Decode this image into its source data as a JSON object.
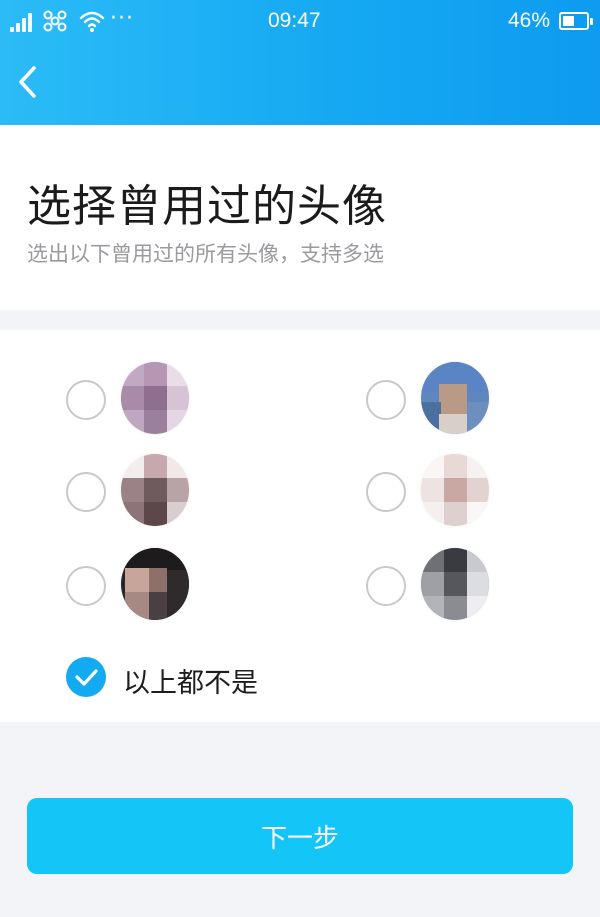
{
  "status_bar": {
    "time": "09:47",
    "battery": "46%",
    "more": "···",
    "icons": [
      "signal-icon",
      "carrier-icon",
      "wifi-icon",
      "battery-icon"
    ]
  },
  "nav": {
    "back_icon": "chevron-left-icon"
  },
  "title": "选择曾用过的头像",
  "subtitle": "选出以下曾用过的所有头像，支持多选",
  "avatar_options": [
    {
      "selected": false,
      "avatar": "pixelated-avatar"
    },
    {
      "selected": false,
      "avatar": "pixelated-avatar"
    },
    {
      "selected": false,
      "avatar": "pixelated-avatar"
    },
    {
      "selected": false,
      "avatar": "pixelated-avatar"
    },
    {
      "selected": false,
      "avatar": "pixelated-avatar"
    },
    {
      "selected": false,
      "avatar": "pixelated-avatar"
    }
  ],
  "none_option": {
    "label": "以上都不是",
    "selected": true
  },
  "next_button": {
    "label": "下一步"
  },
  "colors": {
    "header_gradient_start": "#2bbcf7",
    "header_gradient_end": "#0e9bf0",
    "check_blue": "#14aaf2",
    "button_blue": "#14c5f8",
    "page_background": "#f3f4f8"
  }
}
